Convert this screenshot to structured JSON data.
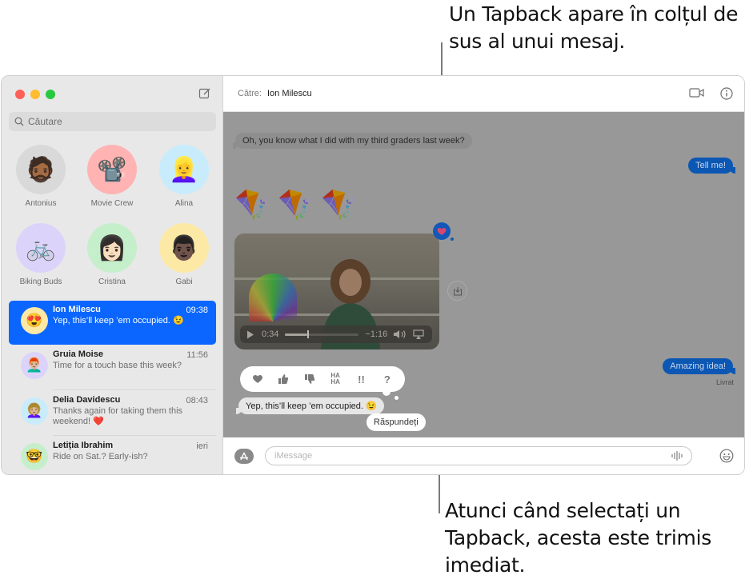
{
  "annotations": {
    "top": "Un Tapback apare în colțul de sus al unui mesaj.",
    "bottom": "Atunci când selectați un Tapback, acesta este trimis imediat."
  },
  "sidebar": {
    "search_placeholder": "Căutare",
    "pinned": [
      {
        "name": "Antonius",
        "icon": "memoji-man-beard",
        "bg": "#d9d9d9"
      },
      {
        "name": "Movie Crew",
        "icon": "film-projector",
        "bg": "#ffb3b3"
      },
      {
        "name": "Alina",
        "icon": "memoji-woman-hat",
        "bg": "#c8ecfb"
      },
      {
        "name": "Biking Buds",
        "icon": "bicycle",
        "bg": "#dcd3fb"
      },
      {
        "name": "Cristina",
        "icon": "memoji-woman",
        "bg": "#c5efcb"
      },
      {
        "name": "Gabi",
        "icon": "memoji-man",
        "bg": "#fde9a6"
      }
    ],
    "conversations": [
      {
        "name": "Ion Milescu",
        "time": "09:38",
        "message": "Yep, this’ll keep ’em occupied. 😉",
        "selected": true,
        "bg": "#fde9a6"
      },
      {
        "name": "Gruia Moise",
        "time": "11:56",
        "message": "Time for a touch base this week?",
        "selected": false,
        "bg": "#dcd3fb"
      },
      {
        "name": "Delia Davidescu",
        "time": "08:43",
        "message": "Thanks again for taking them this weekend! ❤️",
        "selected": false,
        "bg": "#c8ecfb"
      },
      {
        "name": "Letiția Ibrahim",
        "time": "ieri",
        "message": "Ride on Sat.? Early-ish?",
        "selected": false,
        "bg": "#c5efcb"
      }
    ]
  },
  "header": {
    "to_label": "Către:",
    "recipient": "Ion Milescu"
  },
  "chat": {
    "messages": [
      {
        "type": "received",
        "text": "Oh, you know what I did with my third graders last week?"
      },
      {
        "type": "sent",
        "text": "Tell me!"
      },
      {
        "type": "received-emoji",
        "text": "🪁🪁🪁"
      },
      {
        "type": "received-video",
        "elapsed": "0:34",
        "remaining": "−1:16",
        "progress_percent": 30,
        "tapback": "heart"
      },
      {
        "type": "sent",
        "text": "Amazing idea!",
        "status": "Livrat"
      },
      {
        "type": "received",
        "text": "Yep, this’ll keep ’em occupied. 😉"
      }
    ],
    "tapback_options": [
      "heart",
      "thumbs-up",
      "thumbs-down",
      "HA HA",
      "!!",
      "?"
    ],
    "reply_label": "Răspundeți"
  },
  "composer": {
    "placeholder": "iMessage"
  },
  "colors": {
    "accent": "#0a66ff",
    "sent_bubble": "#0c57b3",
    "overlay": "#989898"
  }
}
